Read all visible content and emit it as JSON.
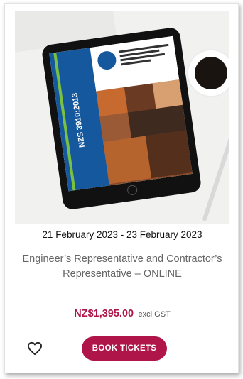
{
  "event": {
    "date_range": "21 February 2023 - 23 February 2023",
    "title": "Engineer’s Representative and Contractor’s Representative – ONLINE",
    "price": "NZ$1,395.00",
    "price_suffix": "excl GST",
    "book_label": "BOOK TICKETS",
    "cover_title": "NZS 3910:2013"
  },
  "colors": {
    "accent": "#b0154a",
    "doc_blue": "#15589e",
    "doc_green": "#7ac043"
  },
  "icons": {
    "wishlist": "heart-outline-icon"
  }
}
